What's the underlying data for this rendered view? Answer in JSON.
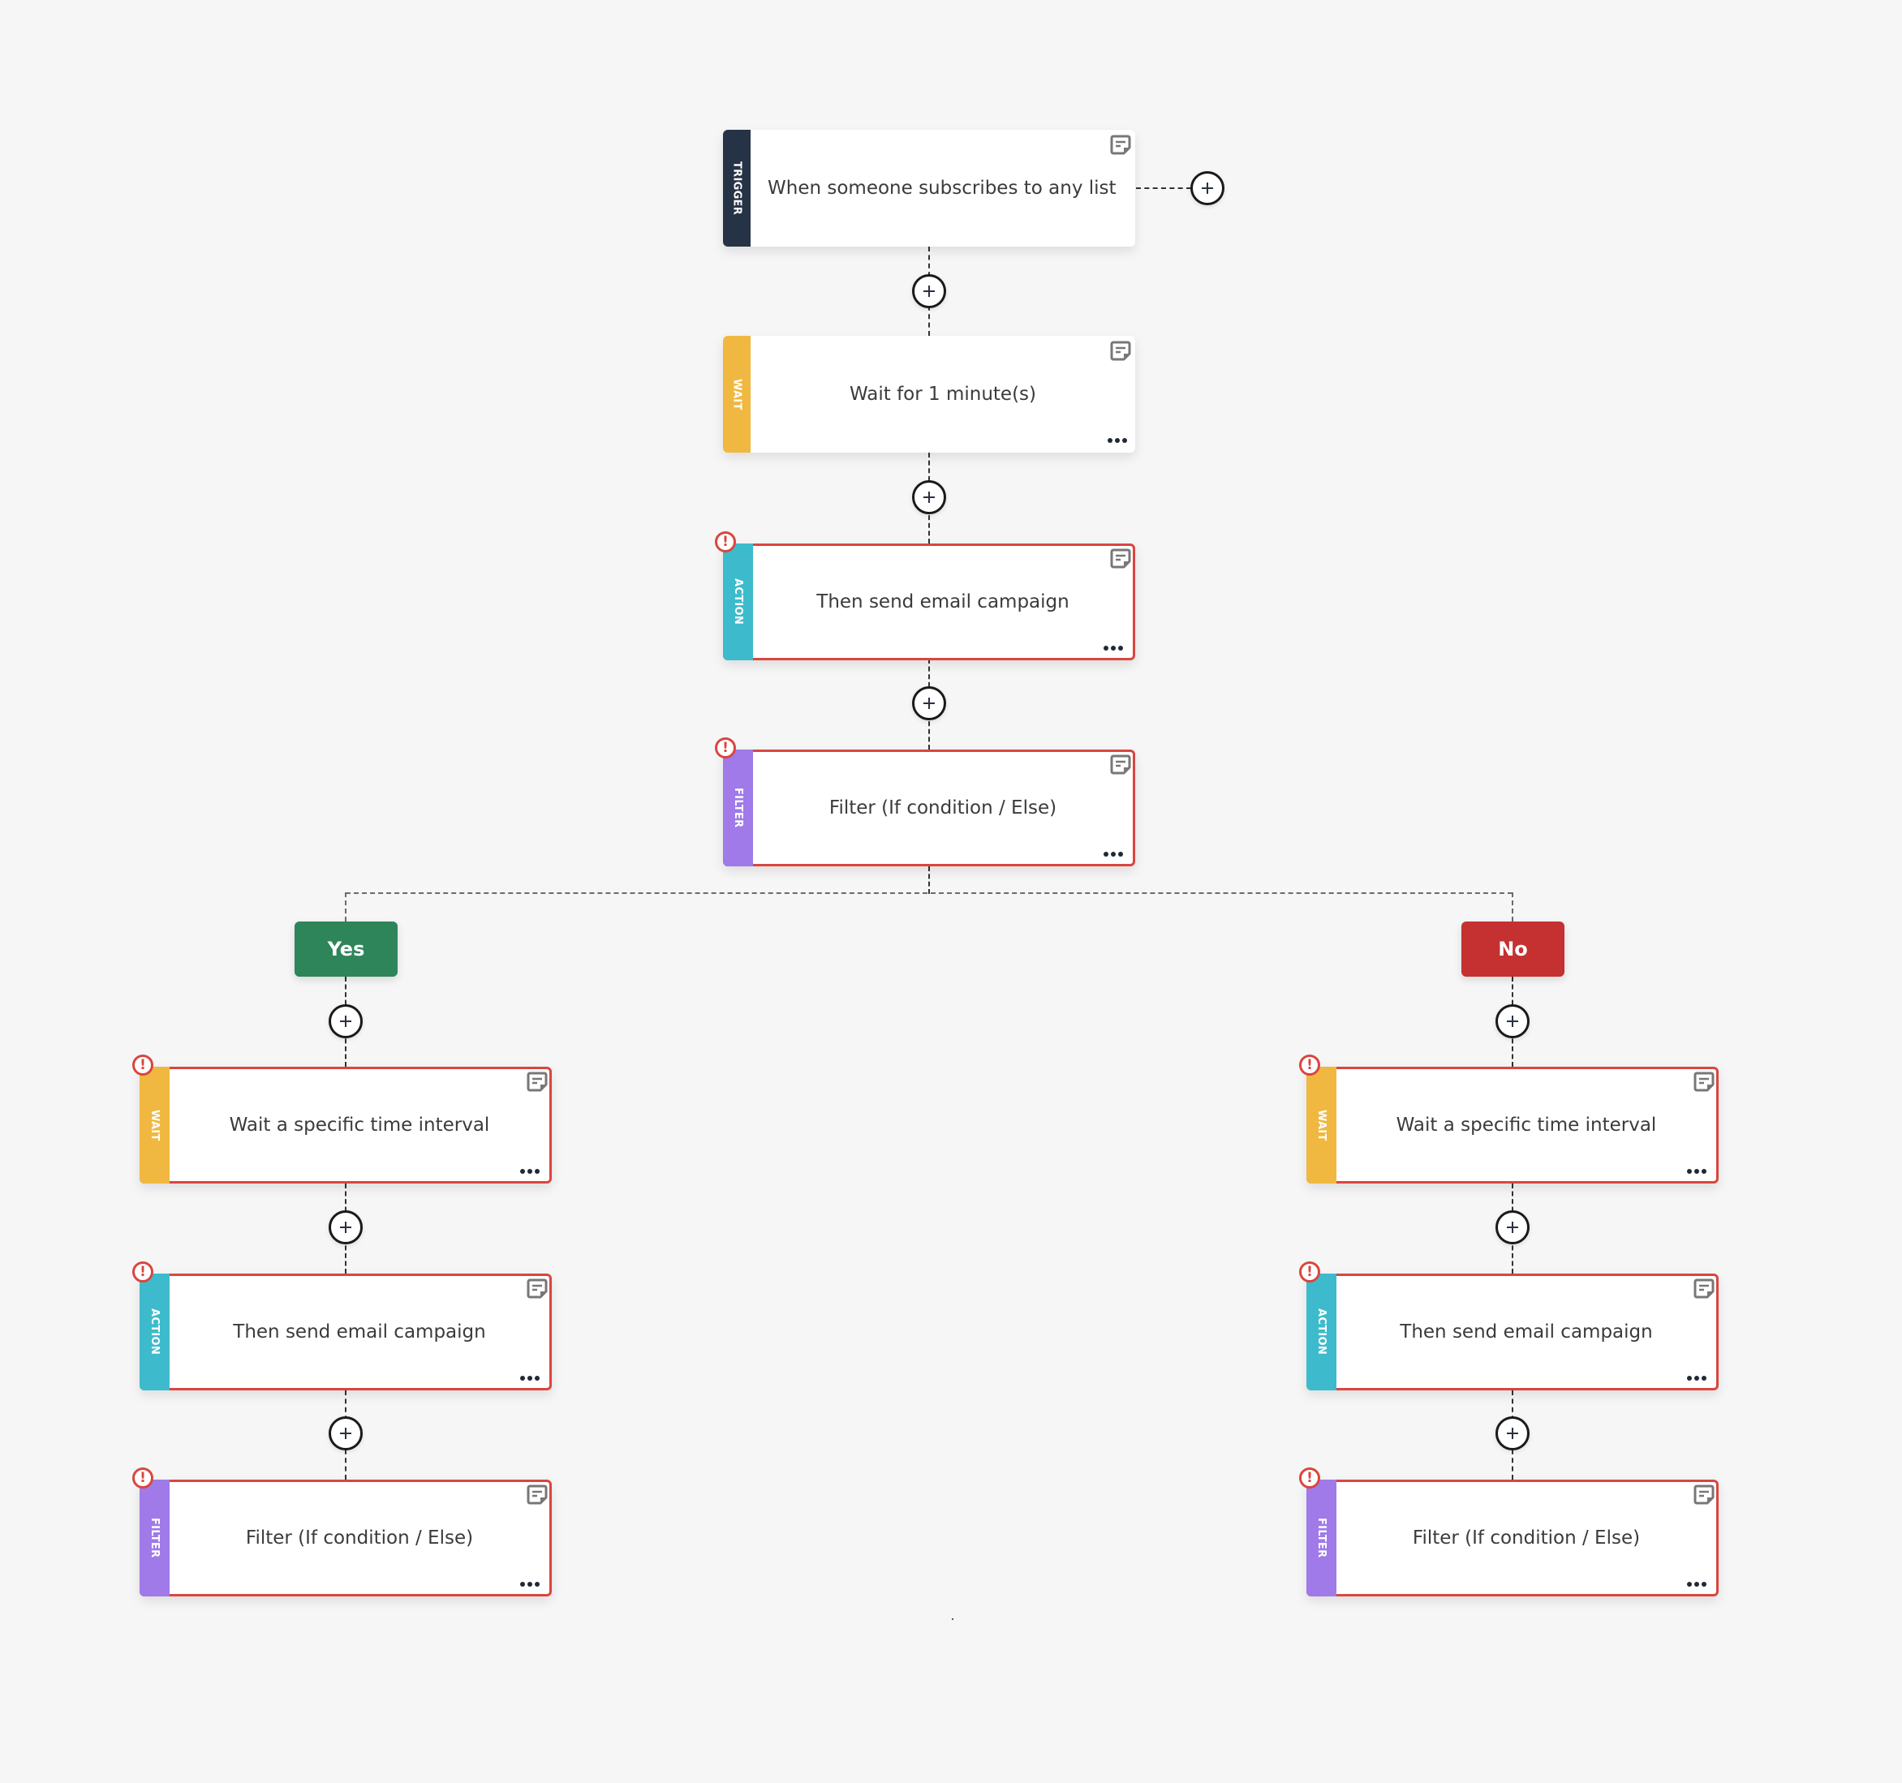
{
  "colors": {
    "background": "#f6f6f6",
    "trigger": "#263346",
    "wait": "#f0b840",
    "action": "#3dbbcc",
    "filter": "#9f7ae8",
    "error": "#d9463f",
    "yes": "#2e855a",
    "no": "#c53030"
  },
  "main_flow": [
    {
      "type": "TRIGGER",
      "title": "When someone subscribes to any list",
      "error": false,
      "has_menu": false
    },
    {
      "type": "WAIT",
      "title": "Wait for 1 minute(s)",
      "error": false,
      "has_menu": true
    },
    {
      "type": "ACTION",
      "title": "Then send email campaign",
      "error": true,
      "has_menu": true
    },
    {
      "type": "FILTER",
      "title": "Filter (If condition / Else)",
      "error": true,
      "has_menu": true
    }
  ],
  "branches": {
    "yes": {
      "label": "Yes",
      "steps": [
        {
          "type": "WAIT",
          "title": "Wait a specific time interval",
          "error": true
        },
        {
          "type": "ACTION",
          "title": "Then send email campaign",
          "error": true
        },
        {
          "type": "FILTER",
          "title": "Filter (If condition / Else)",
          "error": true
        }
      ]
    },
    "no": {
      "label": "No",
      "steps": [
        {
          "type": "WAIT",
          "title": "Wait a specific time interval",
          "error": true
        },
        {
          "type": "ACTION",
          "title": "Then send email campaign",
          "error": true
        },
        {
          "type": "FILTER",
          "title": "Filter (If condition / Else)",
          "error": true
        }
      ]
    }
  },
  "icons": {
    "add": "plus-icon",
    "note": "note-icon",
    "more": "more-dots-icon",
    "error": "exclamation-icon"
  },
  "error_glyph": "!"
}
